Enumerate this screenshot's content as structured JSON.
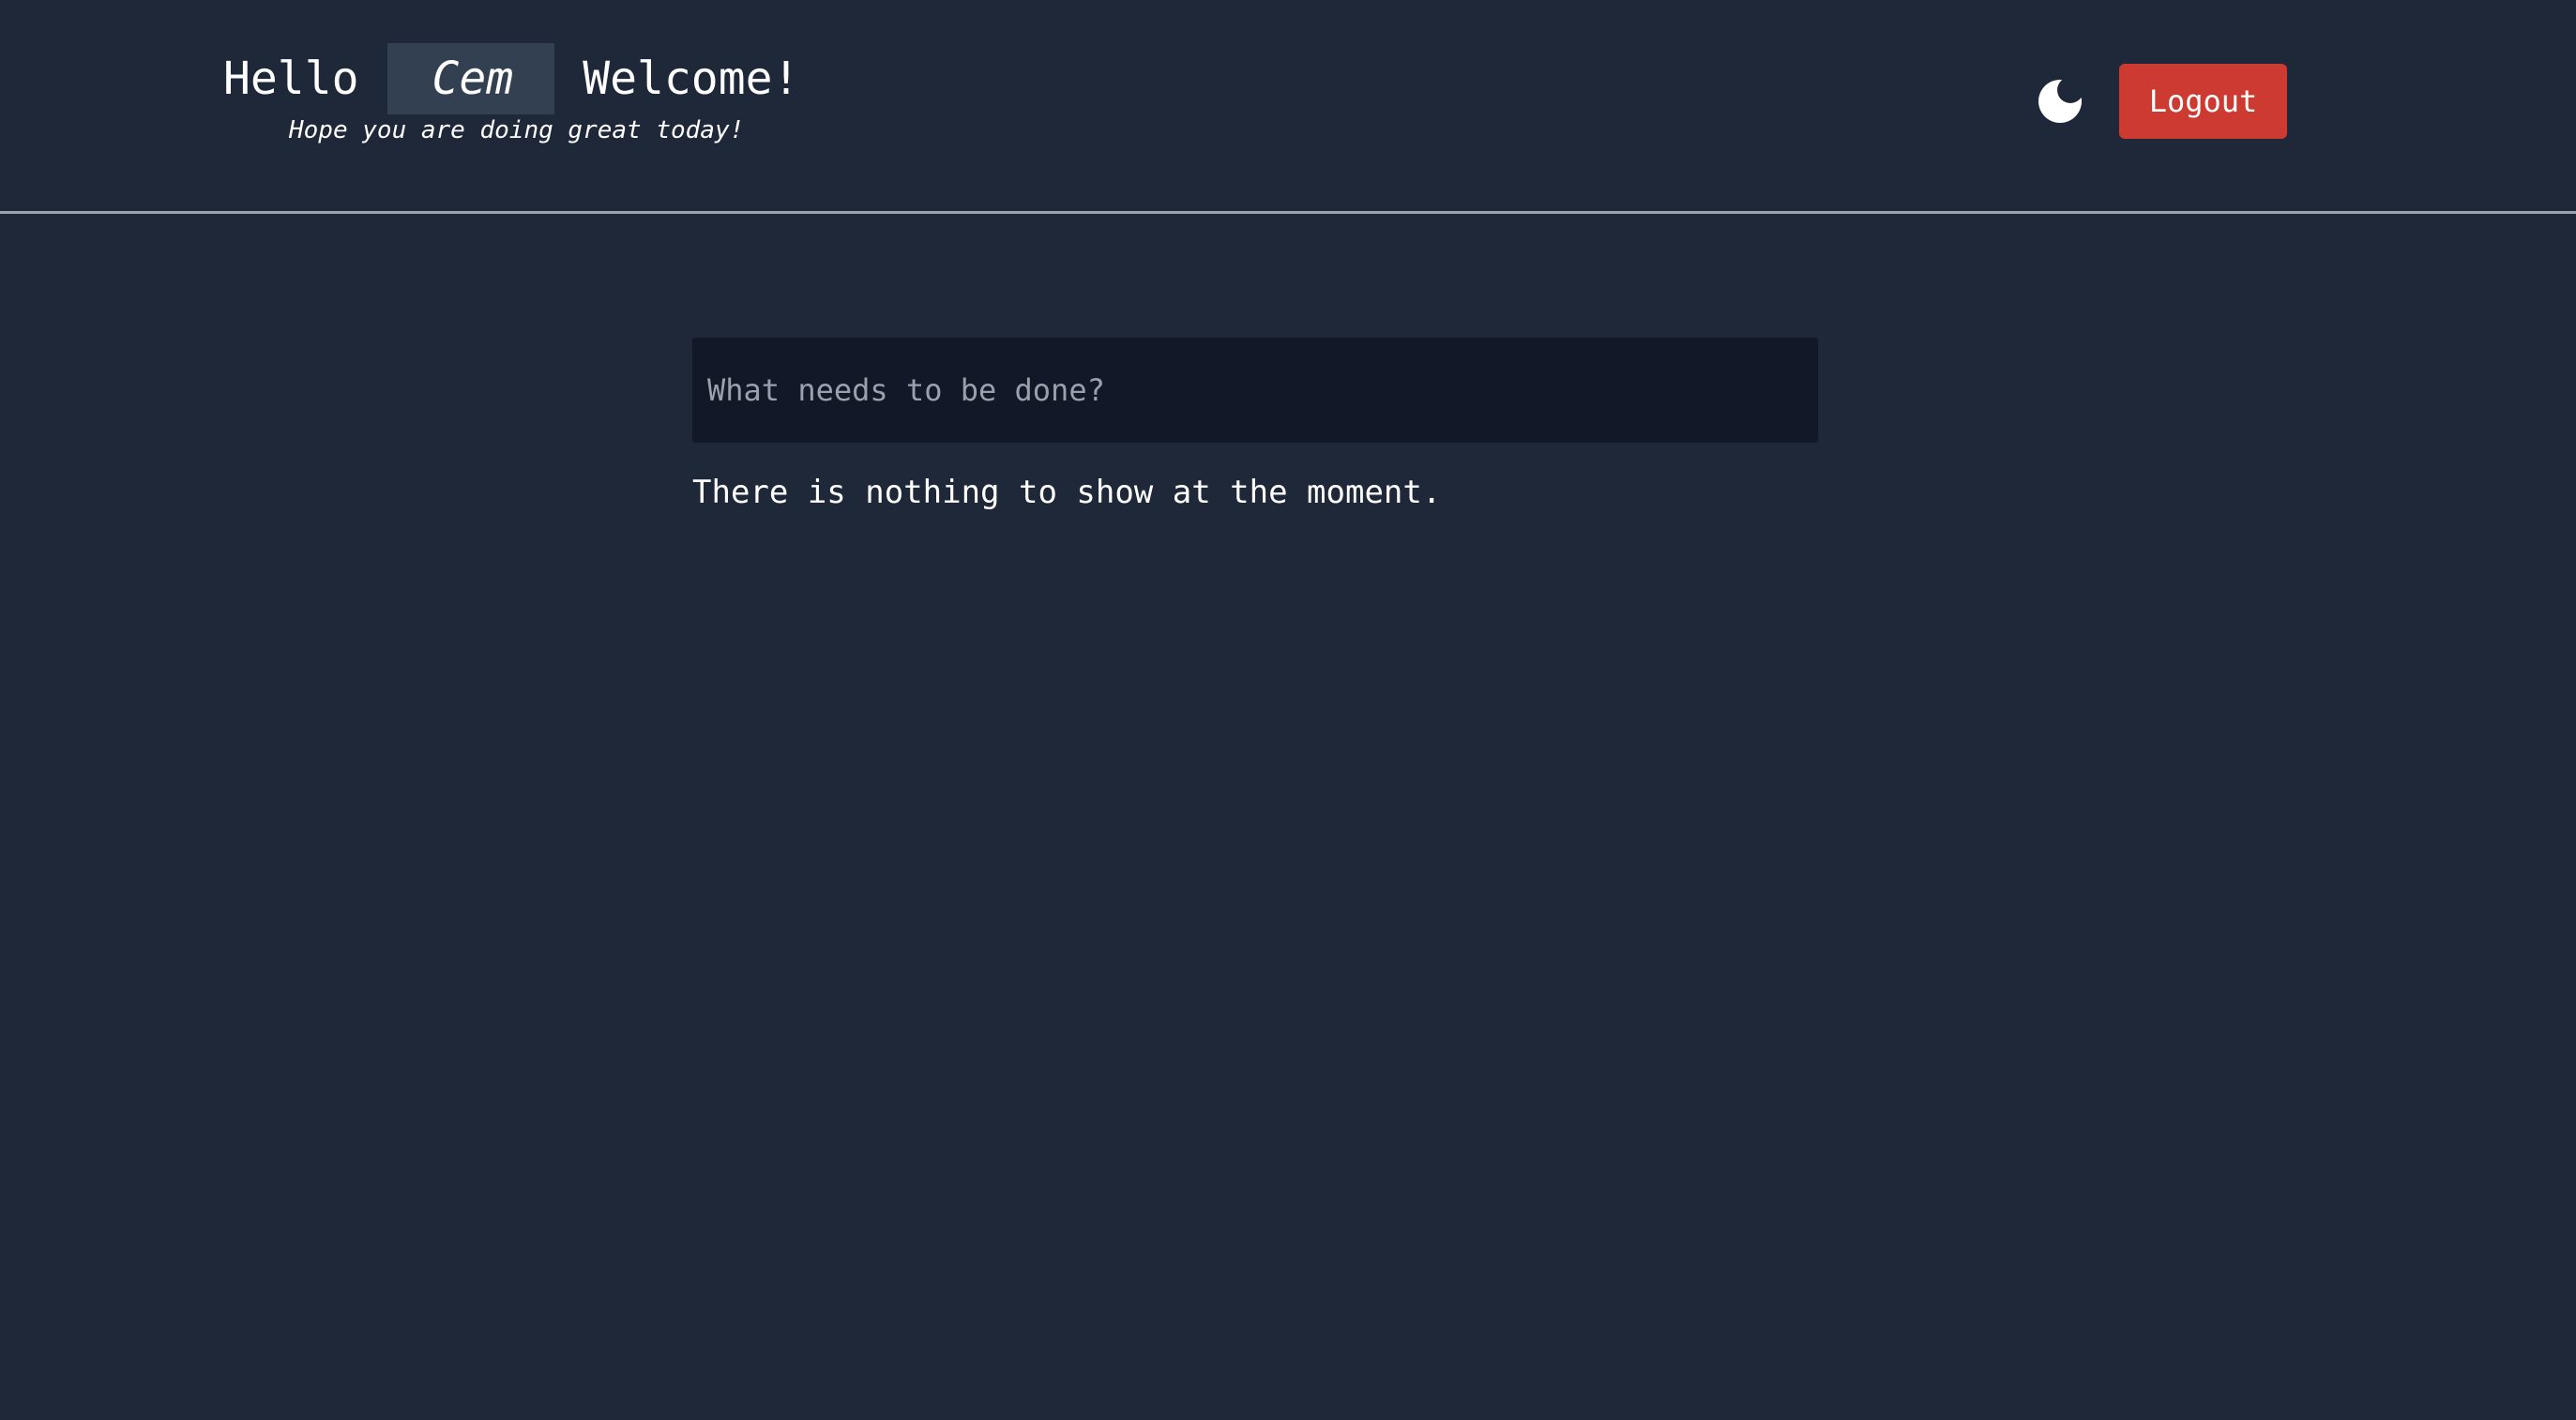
{
  "header": {
    "hello": "Hello",
    "user_name": "Cem",
    "welcome": "Welcome!",
    "subtitle": "Hope you are doing great today!",
    "theme_toggle_icon": "moon-icon",
    "logout_label": "Logout"
  },
  "main": {
    "todo_input": {
      "placeholder": "What needs to be done?",
      "value": ""
    },
    "empty_message": "There is nothing to show at the moment."
  },
  "colors": {
    "background": "#1f2839",
    "name_highlight": "#334052",
    "input_background": "#111827",
    "logout_button": "#cd3a32",
    "divider": "#9aa3b0"
  }
}
